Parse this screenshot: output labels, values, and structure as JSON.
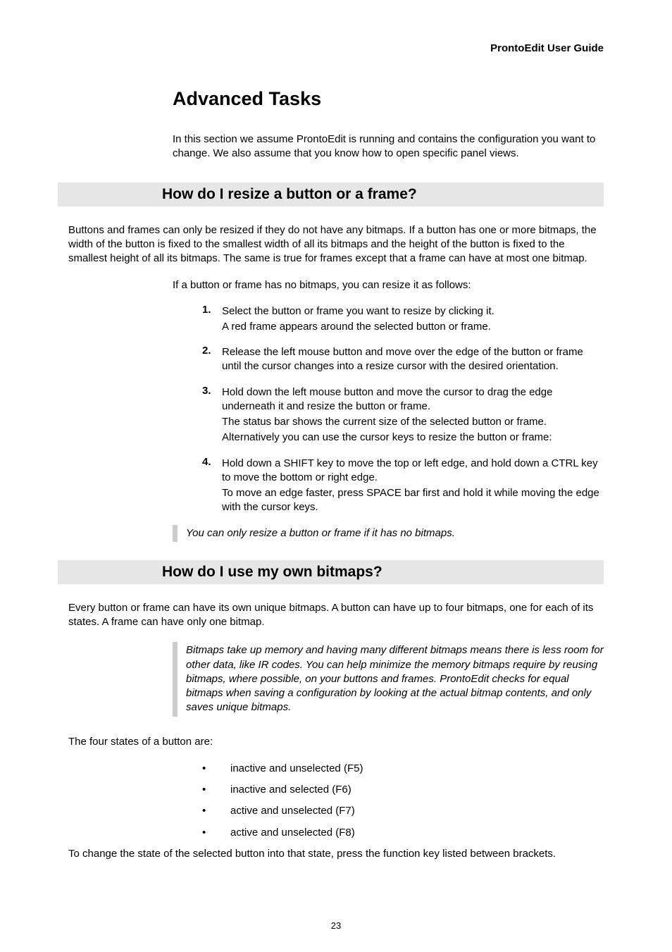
{
  "header": {
    "guide_title": "ProntoEdit User Guide"
  },
  "chapter": {
    "title": "Advanced Tasks",
    "intro": "In this section we assume ProntoEdit is running and contains the configuration you want to change. We also assume that you know how to open specific panel views."
  },
  "section1": {
    "heading": "How do I resize a button or a frame?",
    "para1": "Buttons and frames can only be resized if they do not have any bitmaps. If a button has one or more bitmaps, the width of the button is fixed to the smallest width of all its bitmaps and the height of the button is fixed to the smallest height of all its bitmaps. The same is true for frames except that a frame can have at most one bitmap.",
    "para2": "If a button or frame has no bitmaps, you can resize it as follows:",
    "steps": [
      {
        "num": "1.",
        "lines": [
          "Select the button or frame you want to resize by clicking it.",
          "A red frame appears around the selected button or frame."
        ]
      },
      {
        "num": "2.",
        "lines": [
          "Release the left mouse button and move over the edge of the button or frame until the cursor changes into a resize cursor with the desired orientation."
        ]
      },
      {
        "num": "3.",
        "lines": [
          "Hold down the left mouse button and move the cursor to drag the edge underneath it and resize the button or frame.",
          "The status bar shows the current size of the selected button or frame.",
          "Alternatively you can use the cursor keys to resize the button or frame:"
        ]
      },
      {
        "num": "4.",
        "lines": [
          "Hold down a SHIFT key to move the top or left edge, and hold down a CTRL key to move the bottom or right edge.",
          "To move an edge faster, press SPACE bar first and hold it while moving the edge with the cursor keys."
        ]
      }
    ],
    "note": "You can only resize a button or frame if it has no bitmaps."
  },
  "section2": {
    "heading": "How do I use my own bitmaps?",
    "para1": "Every button or frame can have its own unique bitmaps. A button can have up to four bitmaps, one for each of its states. A frame can have only one bitmap.",
    "note": "Bitmaps take up memory and having many different bitmaps means there is less room for other data, like IR codes. You can help minimize the memory bitmaps require by reusing bitmaps, where possible, on your buttons and frames. ProntoEdit checks for equal bitmaps when saving a configuration by looking at the actual bitmap contents, and only saves unique bitmaps.",
    "para2": "The four states of a button are:",
    "bullets": [
      "inactive and unselected (F5)",
      "inactive and selected (F6)",
      "active and unselected (F7)",
      "active and unselected (F8)"
    ],
    "para3": "To change the state of the selected button into that state, press the function key listed between brackets."
  },
  "footer": {
    "page_number": "23"
  }
}
